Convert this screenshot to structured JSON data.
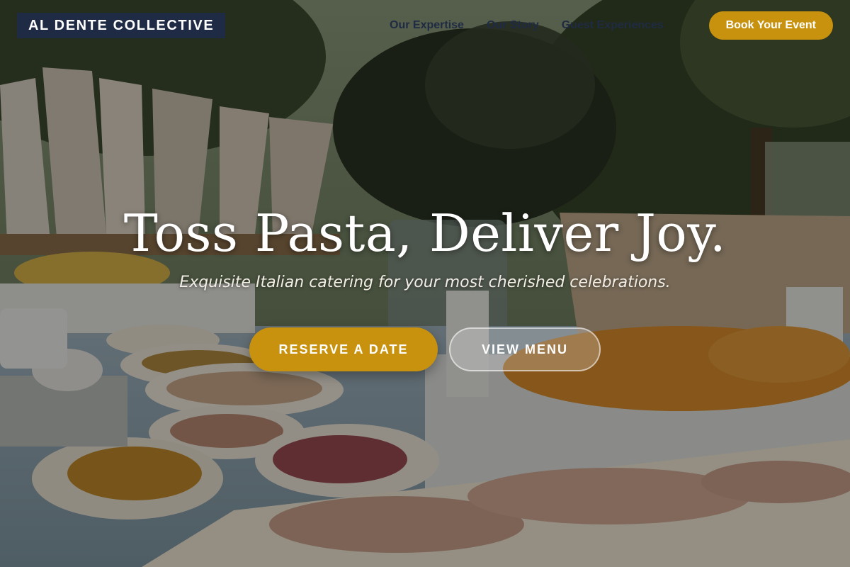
{
  "header": {
    "brand": "AL DENTE COLLECTIVE",
    "nav": [
      {
        "label": "Our Expertise"
      },
      {
        "label": "Our Story"
      },
      {
        "label": "Guest Experiences"
      }
    ],
    "cta_label": "Book Your Event"
  },
  "hero": {
    "title": "Toss Pasta, Deliver Joy.",
    "subtitle": "Exquisite Italian catering for your most cherished celebrations.",
    "primary_button": "RESERVE A DATE",
    "secondary_button": "VIEW MENU"
  },
  "colors": {
    "accent": "#c8920e",
    "brand_bg": "#1f2a44",
    "nav_text": "#1f2a44"
  }
}
